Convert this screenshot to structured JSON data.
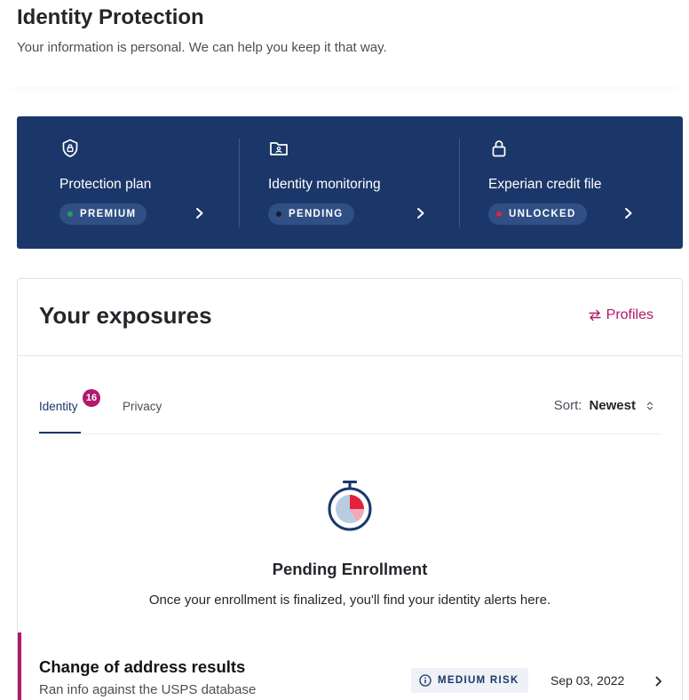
{
  "header": {
    "title": "Identity Protection",
    "subtitle": "Your information is personal. We can help you keep it that way."
  },
  "status_cards": [
    {
      "icon": "shield-lock-icon",
      "label": "Protection plan",
      "status": "PREMIUM",
      "dot_color": "#22a05a"
    },
    {
      "icon": "id-folder-icon",
      "label": "Identity monitoring",
      "status": "PENDING",
      "dot_color": "#1a1d22"
    },
    {
      "icon": "padlock-icon",
      "label": "Experian credit file",
      "status": "UNLOCKED",
      "dot_color": "#e5203f"
    }
  ],
  "exposures": {
    "title": "Your exposures",
    "profiles_label": "Profiles",
    "tabs": [
      {
        "label": "Identity",
        "badge": "16",
        "active": true
      },
      {
        "label": "Privacy",
        "active": false
      }
    ],
    "sort": {
      "label": "Sort:",
      "value": "Newest"
    },
    "empty_state": {
      "title": "Pending Enrollment",
      "text": "Once your enrollment is finalized, you'll find your identity alerts here."
    },
    "alert": {
      "title": "Change of address results",
      "subtitle": "Ran info against the USPS database",
      "risk": "MEDIUM RISK",
      "date": "Sep 03, 2022"
    }
  },
  "colors": {
    "navy": "#1b3769",
    "accent": "#b0196c"
  }
}
